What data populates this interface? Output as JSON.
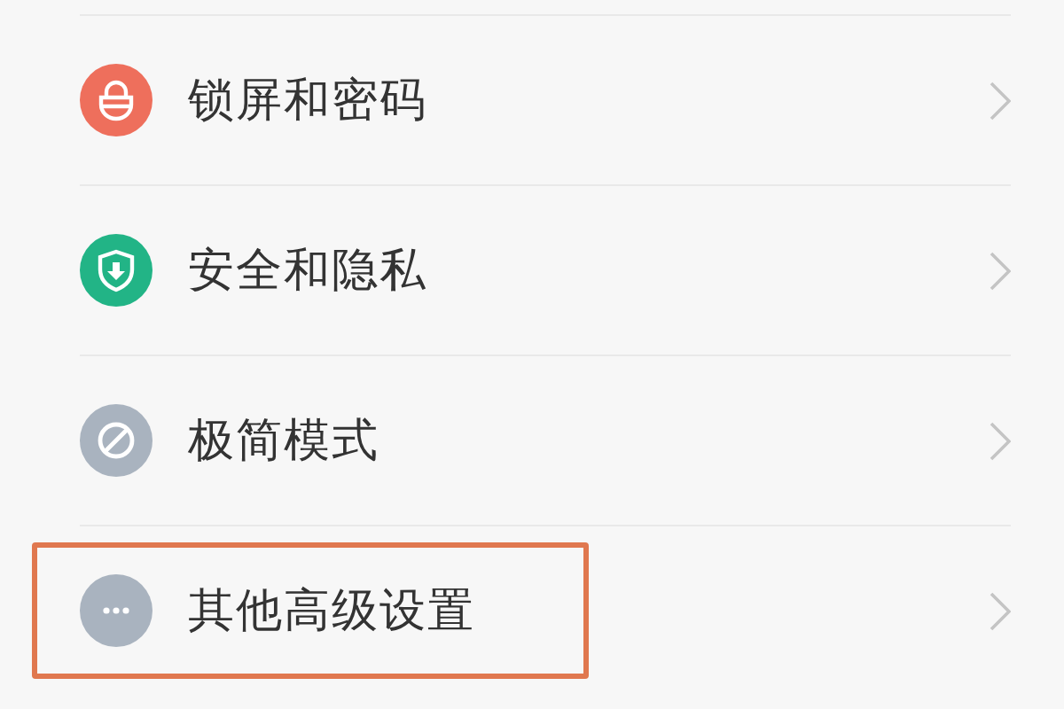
{
  "settings_items": [
    {
      "label": "锁屏和密码",
      "color": "#ee6f5c",
      "highlighted": false
    },
    {
      "label": "安全和隐私",
      "color": "#22b486",
      "highlighted": false
    },
    {
      "label": "极简模式",
      "color": "#a9b3bf",
      "highlighted": false
    },
    {
      "label": "其他高级设置",
      "color": "#a9b3bf",
      "highlighted": true
    }
  ]
}
